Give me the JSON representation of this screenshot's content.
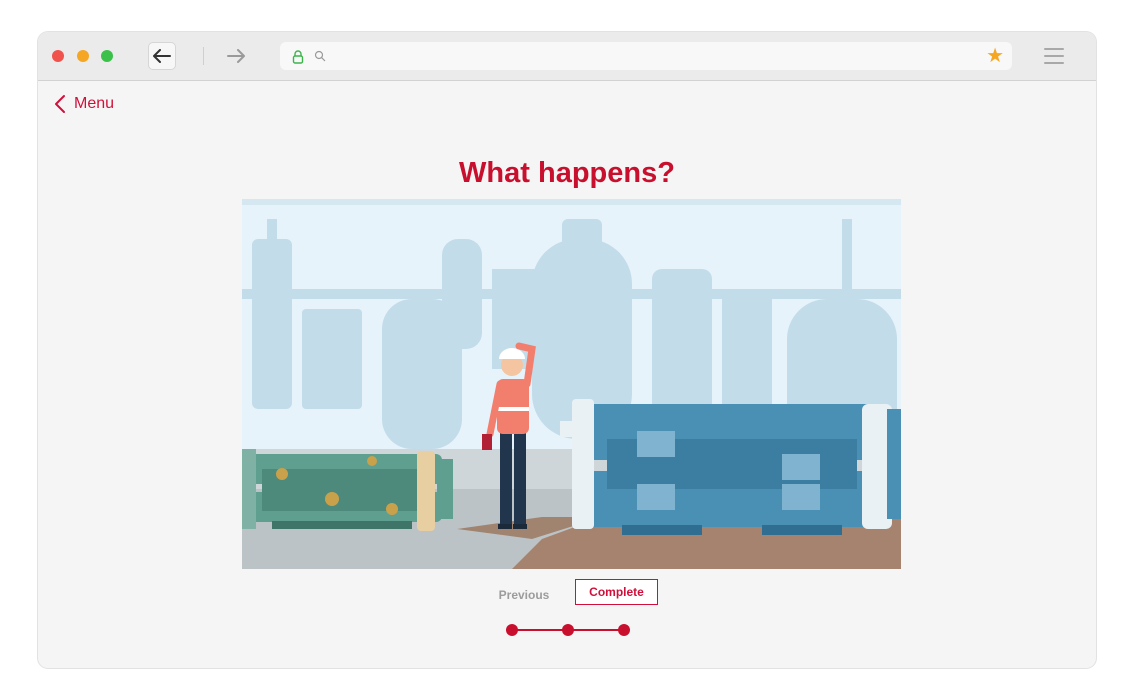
{
  "browser": {
    "address_value": "",
    "icons": [
      "back-arrow-icon",
      "forward-arrow-icon",
      "lock-icon",
      "search-icon",
      "star-icon",
      "hamburger-menu-icon"
    ]
  },
  "page": {
    "menu_label": "Menu",
    "title": "What happens?",
    "previous_label": "Previous",
    "complete_label": "Complete"
  },
  "progress": {
    "steps": 3,
    "current": 3
  },
  "colors": {
    "brand": "#c8102e",
    "scene_sky": "#e6f3fa",
    "equipment_blue": "#4a90b4",
    "equipment_green": "#5e9f90"
  }
}
